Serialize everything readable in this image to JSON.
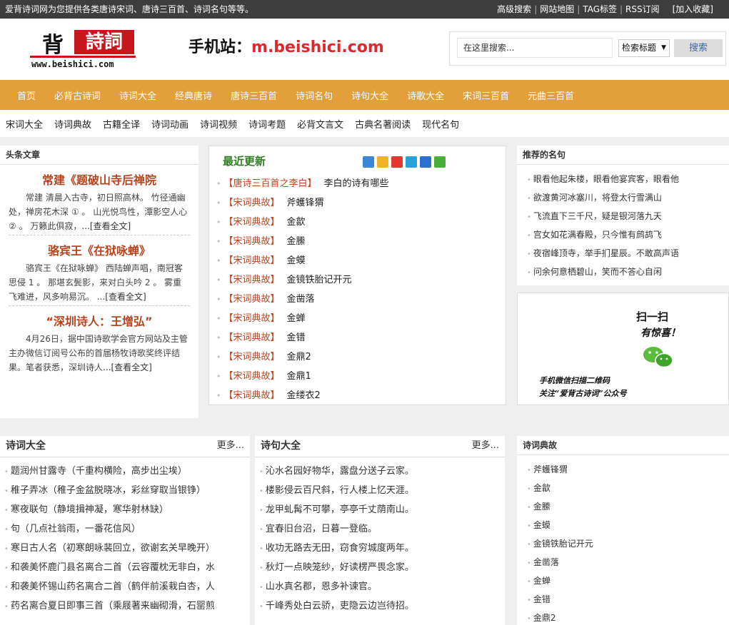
{
  "topbar": {
    "slogan": "爱背诗词网为您提供各类唐诗宋词、唐诗三百首、诗词名句等等。",
    "links": [
      "高级搜索",
      "网站地图",
      "TAG标签",
      "RSS订阅"
    ],
    "favorite": "[加入收藏]"
  },
  "header": {
    "logo_main": "背",
    "logo_red": "詩詞",
    "logo_domain": "www.beishici.com",
    "mobile_label": "手机站：",
    "mobile_url": "m.beishici.com"
  },
  "search": {
    "placeholder": "在这里搜索...",
    "scope": "检索标题",
    "button": "搜索"
  },
  "nav": [
    "首页",
    "必背古诗词",
    "诗词大全",
    "经典唐诗",
    "唐诗三百首",
    "诗词名句",
    "诗句大全",
    "诗歌大全",
    "宋词三百首",
    "元曲三百首"
  ],
  "subnav": [
    "宋词大全",
    "诗词典故",
    "古籍全译",
    "诗词动画",
    "诗词视频",
    "诗词考题",
    "必背文言文",
    "古典名著阅读",
    "现代名句"
  ],
  "headline": {
    "title": "头条文章",
    "read_more": "...[查看全文]",
    "articles": [
      {
        "title": "常建《题破山寺后禅院",
        "body": "常建 清晨入古寺，初日照高林。 竹径通幽处，禅房花木深 ① 。 山光悦鸟性，潭影空人心 ② 。 万籁此俱寂，"
      },
      {
        "title": "骆宾王《在狱咏蝉》",
        "body": "骆宾王《在狱咏蝉》 西陆蝉声唱，南冠客思侵 1 。 那堪玄鬓影，来对白头吟 2 。 雾重飞难进，风多响易沉。 "
      },
      {
        "title": "“深圳诗人：王增弘”",
        "body": "4月26日，据中国诗歌学会官方网站及主管主办微信订阅号公布的首届杨牧诗歌奖终评结果。笔者获悉，深圳诗人"
      }
    ]
  },
  "recent": {
    "title": "最近更新",
    "items": [
      {
        "cat": "【唐诗三百首之李白】",
        "text": "李白的诗有哪些"
      },
      {
        "cat": "【宋词典故】",
        "text": "斧蠖锋猬"
      },
      {
        "cat": "【宋词典故】",
        "text": "金歙"
      },
      {
        "cat": "【宋词典故】",
        "text": "金縢"
      },
      {
        "cat": "【宋词典故】",
        "text": "金蟆"
      },
      {
        "cat": "【宋词典故】",
        "text": "金镜铁胎记开元"
      },
      {
        "cat": "【宋词典故】",
        "text": "金凿落"
      },
      {
        "cat": "【宋词典故】",
        "text": "金蝉"
      },
      {
        "cat": "【宋词典故】",
        "text": "金错"
      },
      {
        "cat": "【宋词典故】",
        "text": "金鼎2"
      },
      {
        "cat": "【宋词典故】",
        "text": "金鼎1"
      },
      {
        "cat": "【宋词典故】",
        "text": "金缕衣2"
      }
    ]
  },
  "famous": {
    "title": "推荐的名句",
    "items": [
      "眼看他起朱楼，眼看他宴宾客，眼看他",
      "欲渡黄河冰塞川，将登太行雪满山",
      "飞流直下三千尺，疑是银河落九天",
      "宫女如花满春殿，只今惟有鹧鸪飞",
      "夜宿峰顶寺，举手扪星辰。不敢高声语",
      "问余何意栖碧山，笑而不答心自闲"
    ]
  },
  "qr": {
    "line1": "扫一扫",
    "line2": "有惊喜！",
    "line3": "手机微信扫描二维码",
    "line4": "关注“爱背古诗词”公众号"
  },
  "poems": {
    "title": "诗词大全",
    "more": "更多...",
    "items": [
      "题润州甘露寺（千重构横险，高步出尘埃）",
      "稚子弄冰（稚子金盆脱晓冰，彩丝穿取当银铮）",
      "寒夜联句（静境揖神凝，寒华射林缺）",
      "句（几点社翁雨，一番花信风）",
      "寒日古人名（初寒朗咏裴回立，欲谢玄关早晚开）",
      "和袭美怀鹿门县名离合二首（云容覆枕无非白，水",
      "和袭美怀锡山药名离合二首（鹤伴前溪栽白杏，人",
      "药名离合夏日即事三首（乘屐著来幽砌滑，石罂煎"
    ]
  },
  "lines": {
    "title": "诗句大全",
    "more": "更多...",
    "items": [
      "沁水名园好物华，露盘分送子云家。",
      "楼影侵云百尺斜，行人楼上忆天涯。",
      "龙甲虬髯不可攀，亭亭千丈荫南山。",
      "宜春旧台沼，日暮一登临。",
      "收功无路去无田，窃食穷城度两年。",
      "秋灯一点映笼纱，好读楞严畏念家。",
      "山水真名郡，恩多补谏官。",
      "千峰秀处白云骄，吏隐云边岂待招。"
    ]
  },
  "allusion": {
    "title": "诗词典故",
    "items": [
      "斧蠖锋猬",
      "金歙",
      "金縢",
      "金蟆",
      "金镜铁胎记开元",
      "金凿落",
      "金蝉",
      "金错",
      "金鼎2"
    ]
  },
  "colors": {
    "nav": "#e3a03a",
    "accent_red": "#c8161d",
    "category": "#b5441f",
    "recent_title": "#2f7d23"
  }
}
